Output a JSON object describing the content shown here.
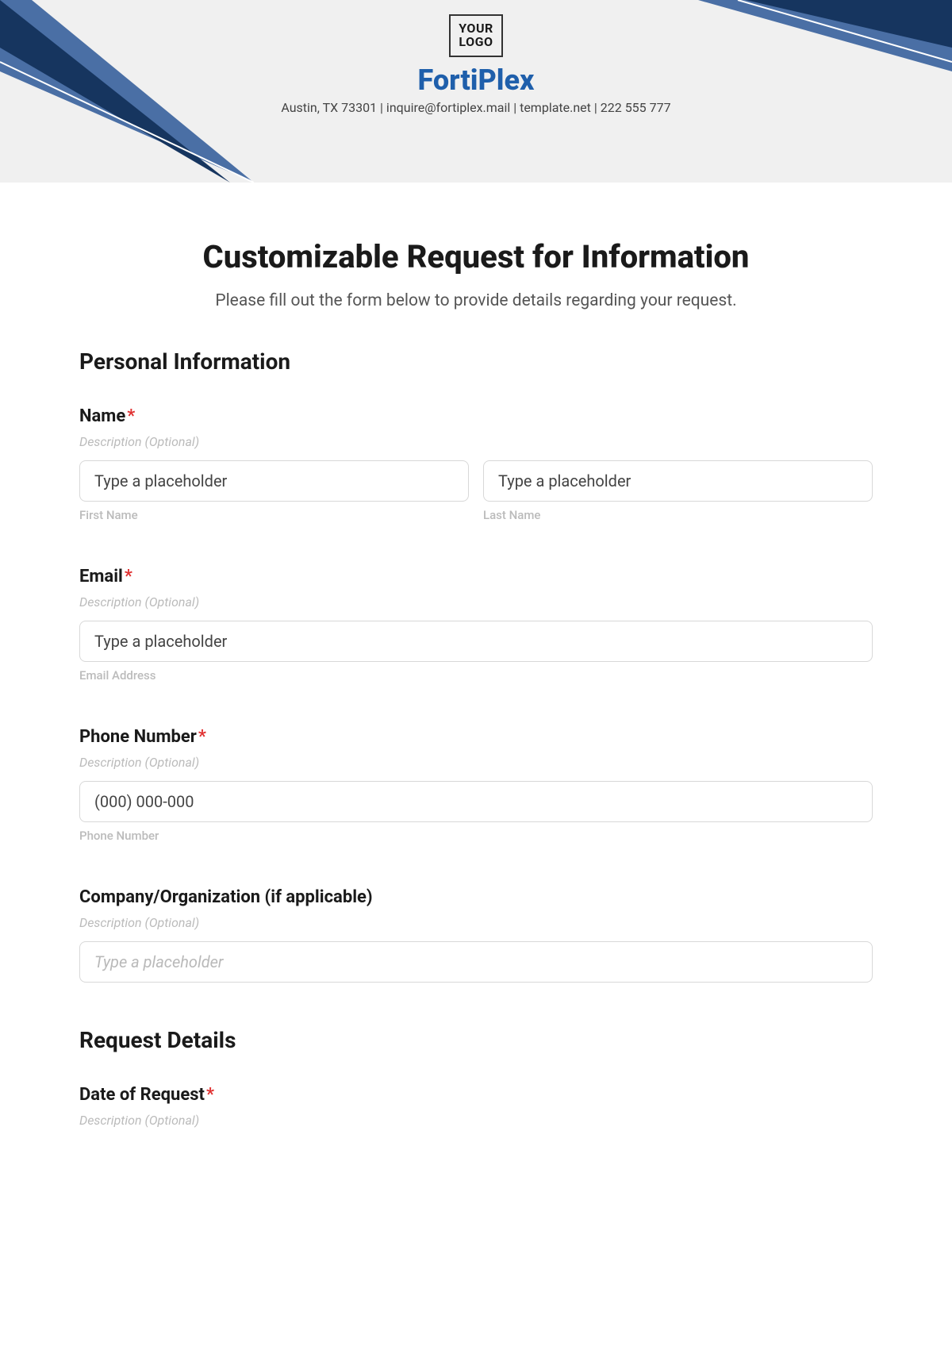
{
  "header": {
    "logo_line1": "YOUR",
    "logo_line2": "LOGO",
    "company": "FortiPlex",
    "subline": "Austin, TX 73301 | inquire@fortiplex.mail | template.net | 222 555 777"
  },
  "form": {
    "title": "Customizable Request for Information",
    "intro": "Please fill out the form below to provide details regarding your request.",
    "section_personal": "Personal Information",
    "section_request": "Request Details",
    "desc_optional": "Description (Optional)",
    "placeholder_generic": "Type a placeholder",
    "name": {
      "label": "Name",
      "first_sub": "First Name",
      "last_sub": "Last Name",
      "first_value": "Type a placeholder",
      "last_value": "Type a placeholder"
    },
    "email": {
      "label": "Email",
      "sub": "Email Address",
      "value": "Type a placeholder"
    },
    "phone": {
      "label": "Phone Number",
      "sub": "Phone Number",
      "value": "(000) 000-000"
    },
    "company": {
      "label": "Company/Organization (if applicable)"
    },
    "date_request": {
      "label": "Date of Request"
    }
  }
}
